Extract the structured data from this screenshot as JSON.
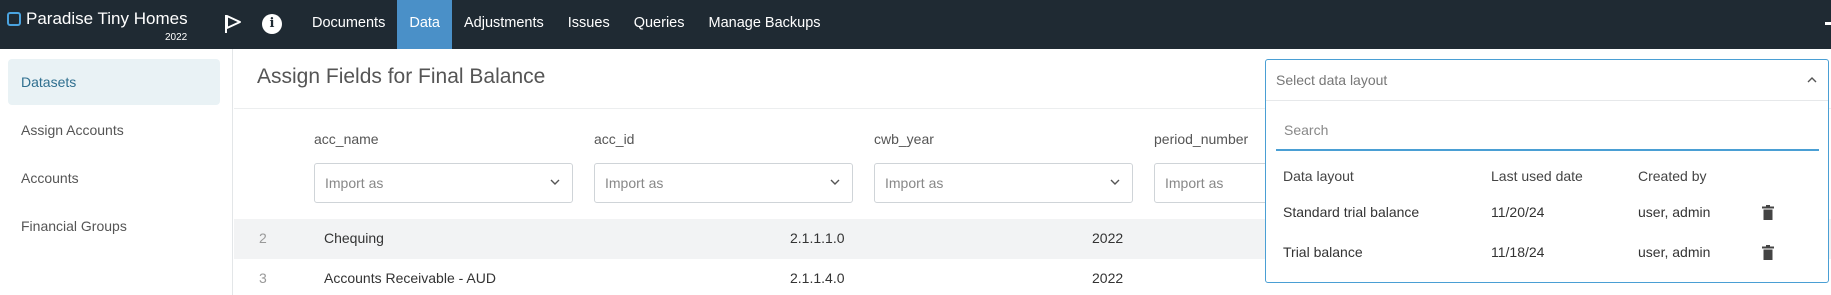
{
  "app": {
    "name": "Paradise Tiny Homes",
    "year": "2022"
  },
  "nav": {
    "items": [
      {
        "label": "Documents",
        "active": false
      },
      {
        "label": "Data",
        "active": true
      },
      {
        "label": "Adjustments",
        "active": false
      },
      {
        "label": "Issues",
        "active": false
      },
      {
        "label": "Queries",
        "active": false
      },
      {
        "label": "Manage Backups",
        "active": false
      }
    ],
    "icons": [
      "flag-icon",
      "info-icon"
    ]
  },
  "sidebar": {
    "items": [
      {
        "label": "Datasets",
        "active": true
      },
      {
        "label": "Assign Accounts",
        "active": false
      },
      {
        "label": "Accounts",
        "active": false
      },
      {
        "label": "Financial Groups",
        "active": false
      }
    ]
  },
  "main": {
    "title": "Assign Fields for Final Balance",
    "columns": [
      {
        "header": "acc_name",
        "placeholder": "Import as"
      },
      {
        "header": "acc_id",
        "placeholder": "Import as"
      },
      {
        "header": "cwb_year",
        "placeholder": "Import as"
      },
      {
        "header": "period_number",
        "placeholder": "Import as"
      }
    ],
    "rows": [
      {
        "num": "2",
        "acc_name": "Chequing",
        "acc_id": "2.1.1.1.0",
        "cwb_year": "2022"
      },
      {
        "num": "3",
        "acc_name": "Accounts Receivable - AUD",
        "acc_id": "2.1.1.4.0",
        "cwb_year": "2022"
      }
    ]
  },
  "layout_dropdown": {
    "placeholder": "Select data layout",
    "search_placeholder": "Search",
    "headers": {
      "layout": "Data layout",
      "last_used": "Last used date",
      "created_by": "Created by"
    },
    "items": [
      {
        "layout": "Standard trial balance",
        "last_used": "11/20/24",
        "created_by": "user, admin"
      },
      {
        "layout": "Trial balance",
        "last_used": "11/18/24",
        "created_by": "user, admin"
      }
    ]
  },
  "colors": {
    "topbar": "#1f2a33",
    "nav_active": "#4a90c8",
    "accent": "#4a9fd4",
    "sidebar_active_bg": "#e9f2f5"
  }
}
